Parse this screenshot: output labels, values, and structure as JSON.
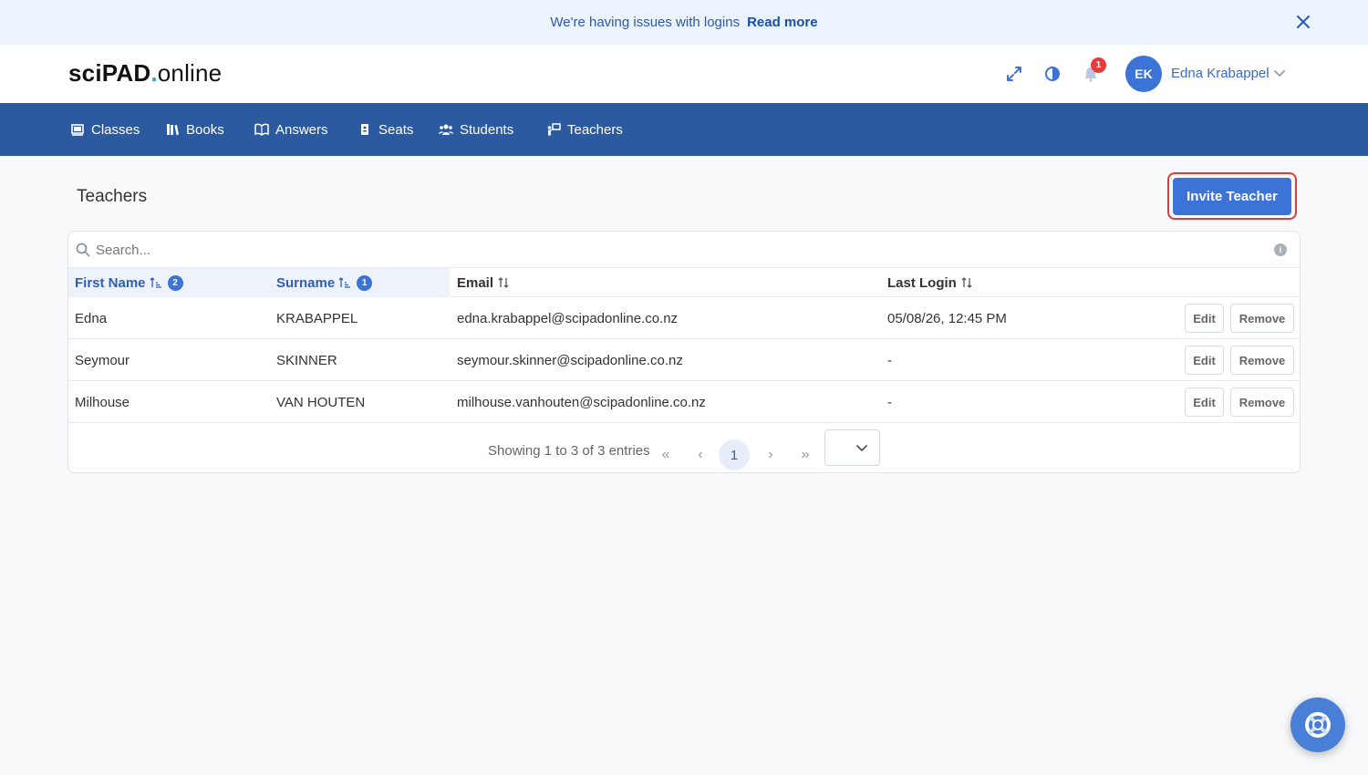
{
  "banner": {
    "message": "We're having issues with logins",
    "link_label": "Read more"
  },
  "header": {
    "logo_bold": "sciPAD",
    "logo_dot": ".",
    "logo_rest": "online",
    "notification_count": "1",
    "user_initials": "EK",
    "user_name": "Edna Krabappel"
  },
  "nav": {
    "items": [
      {
        "label": "Classes",
        "icon": "classes-icon"
      },
      {
        "label": "Books",
        "icon": "books-icon"
      },
      {
        "label": "Answers",
        "icon": "answers-icon"
      },
      {
        "label": "Seats",
        "icon": "seats-icon"
      },
      {
        "label": "Students",
        "icon": "students-icon"
      },
      {
        "label": "Teachers",
        "icon": "teachers-icon"
      }
    ]
  },
  "page": {
    "title": "Teachers",
    "invite_label": "Invite Teacher"
  },
  "table": {
    "search_placeholder": "Search...",
    "columns": [
      {
        "label": "First Name",
        "sort_order": "2"
      },
      {
        "label": "Surname",
        "sort_order": "1"
      },
      {
        "label": "Email"
      },
      {
        "label": "Last Login"
      }
    ],
    "rows": [
      {
        "first": "Edna",
        "surname": "KRABAPPEL",
        "email": "edna.krabappel@scipadonline.co.nz",
        "last_login": "05/08/26, 12:45 PM"
      },
      {
        "first": "Seymour",
        "surname": "SKINNER",
        "email": "seymour.skinner@scipadonline.co.nz",
        "last_login": "-"
      },
      {
        "first": "Milhouse",
        "surname": "VAN HOUTEN",
        "email": "milhouse.vanhouten@scipadonline.co.nz",
        "last_login": "-"
      }
    ],
    "edit_label": "Edit",
    "remove_label": "Remove"
  },
  "pager": {
    "info": "Showing 1 to 3 of 3 entries",
    "first": "«",
    "prev": "‹",
    "current_page": "1",
    "next": "›",
    "last": "»"
  },
  "colors": {
    "nav_bg": "#2c5aa0",
    "accent": "#3b73d6",
    "alert": "#e63b3b"
  }
}
